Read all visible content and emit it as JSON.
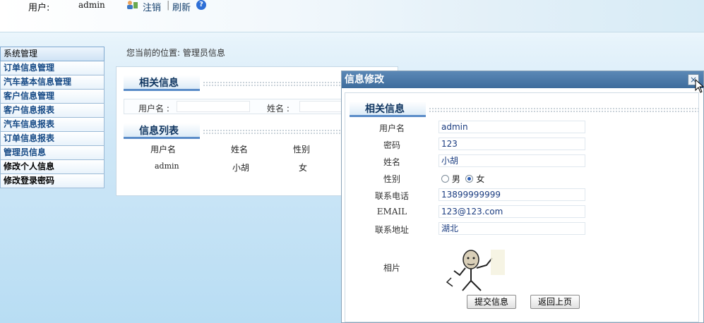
{
  "topbar": {
    "user_label": "用户:",
    "user_value": "admin",
    "logout": "注销",
    "separator": "|",
    "refresh": "刷新",
    "help_glyph": "?"
  },
  "sidebar": {
    "header": "系统管理",
    "items": [
      {
        "label": "订单信息管理"
      },
      {
        "label": "汽车基本信息管理"
      },
      {
        "label": "客户信息管理"
      },
      {
        "label": "客户信息报表"
      },
      {
        "label": "汽车信息报表"
      },
      {
        "label": "订单信息报表"
      },
      {
        "label": "管理员信息"
      },
      {
        "label": "修改个人信息"
      },
      {
        "label": "修改登录密码"
      }
    ]
  },
  "breadcrumb": "您当前的位置: 管理员信息",
  "main": {
    "section_related": "相关信息",
    "username_label": "用户名 :",
    "name_label": "姓名 :",
    "section_list": "信息列表",
    "columns": [
      "用户名",
      "姓名",
      "性别"
    ],
    "rows": [
      [
        "admin",
        "小胡",
        "女"
      ]
    ]
  },
  "modal": {
    "title": "信息修改",
    "close_glyph": "×",
    "section": "相关信息",
    "fields": {
      "username": {
        "label": "用户名",
        "value": "admin"
      },
      "password": {
        "label": "密码",
        "value": "123"
      },
      "name": {
        "label": "姓名",
        "value": "小胡"
      },
      "gender": {
        "label": "性别",
        "option_male": "男",
        "option_female": "女",
        "selected": "女"
      },
      "phone": {
        "label": "联系电话",
        "value": "13899999999"
      },
      "email": {
        "label": "EMAIL",
        "value": "123@123.com"
      },
      "address": {
        "label": "联系地址",
        "value": "湖北"
      },
      "photo": {
        "label": "相片"
      }
    },
    "submit_button": "提交信息",
    "back_button": "返回上页"
  },
  "colors": {
    "accent": "#3e6c9c",
    "link": "#164a86"
  }
}
